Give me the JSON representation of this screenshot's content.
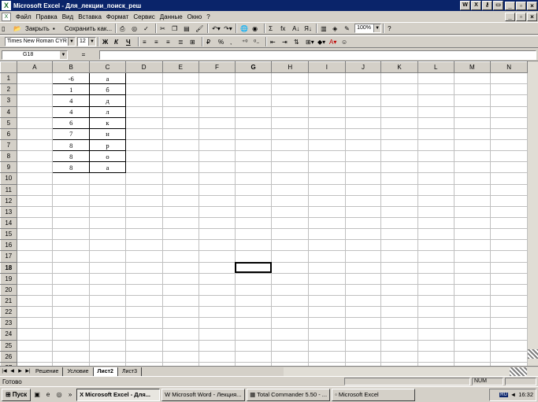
{
  "window": {
    "title": "Microsoft Excel - Для_лекции_поиск_реш",
    "min": "_",
    "max": "▫",
    "close": "×"
  },
  "menu": {
    "items": [
      "Файл",
      "Правка",
      "Вид",
      "Вставка",
      "Формат",
      "Сервис",
      "Данные",
      "Окно",
      "?"
    ],
    "doc_min": "_",
    "doc_max": "▫",
    "doc_close": "×"
  },
  "toolbar1": {
    "close_label": "Закрыть",
    "saveas_label": "Сохранить как...",
    "zoom": "100%",
    "autosum": "Σ",
    "fx": "fx"
  },
  "toolbar2": {
    "font": "Times New Roman CYR",
    "size": "12",
    "bold": "Ж",
    "italic": "К",
    "underline": "Ч",
    "percent": "%",
    "comma": ","
  },
  "formula": {
    "name": "G18",
    "eq": "="
  },
  "columns": [
    "A",
    "B",
    "C",
    "D",
    "E",
    "F",
    "G",
    "H",
    "I",
    "J",
    "K",
    "L",
    "M",
    "N"
  ],
  "rows": [
    {
      "n": "1",
      "b": "-6",
      "c": "а"
    },
    {
      "n": "2",
      "b": "1",
      "c": "б"
    },
    {
      "n": "3",
      "b": "4",
      "c": "д"
    },
    {
      "n": "4",
      "b": "4",
      "c": "л"
    },
    {
      "n": "5",
      "b": "6",
      "c": "к"
    },
    {
      "n": "6",
      "b": "7",
      "c": "н"
    },
    {
      "n": "7",
      "b": "8",
      "c": "р"
    },
    {
      "n": "8",
      "b": "8",
      "c": "о"
    },
    {
      "n": "9",
      "b": "8",
      "c": "а"
    },
    {
      "n": "10"
    },
    {
      "n": "11"
    },
    {
      "n": "12"
    },
    {
      "n": "13"
    },
    {
      "n": "14"
    },
    {
      "n": "15"
    },
    {
      "n": "16"
    },
    {
      "n": "17"
    },
    {
      "n": "18"
    },
    {
      "n": "19"
    },
    {
      "n": "20"
    },
    {
      "n": "21"
    },
    {
      "n": "22"
    },
    {
      "n": "23"
    },
    {
      "n": "24"
    },
    {
      "n": "25"
    },
    {
      "n": "26"
    },
    {
      "n": "27"
    }
  ],
  "active_cell": {
    "row": "18",
    "col": "G"
  },
  "tabs": [
    "Решение",
    "Условие",
    "Лист2",
    "Лист3"
  ],
  "active_tab": "Лист2",
  "status": {
    "ready": "Готово",
    "num": "NUM"
  },
  "taskbar": {
    "start": "Пуск",
    "items": [
      "Microsoft Excel - Для...",
      "Microsoft Word - Лекция...",
      "Total Commander 5.50 - ...",
      "Microsoft Excel"
    ],
    "lang": "RU",
    "time": "16:32"
  }
}
